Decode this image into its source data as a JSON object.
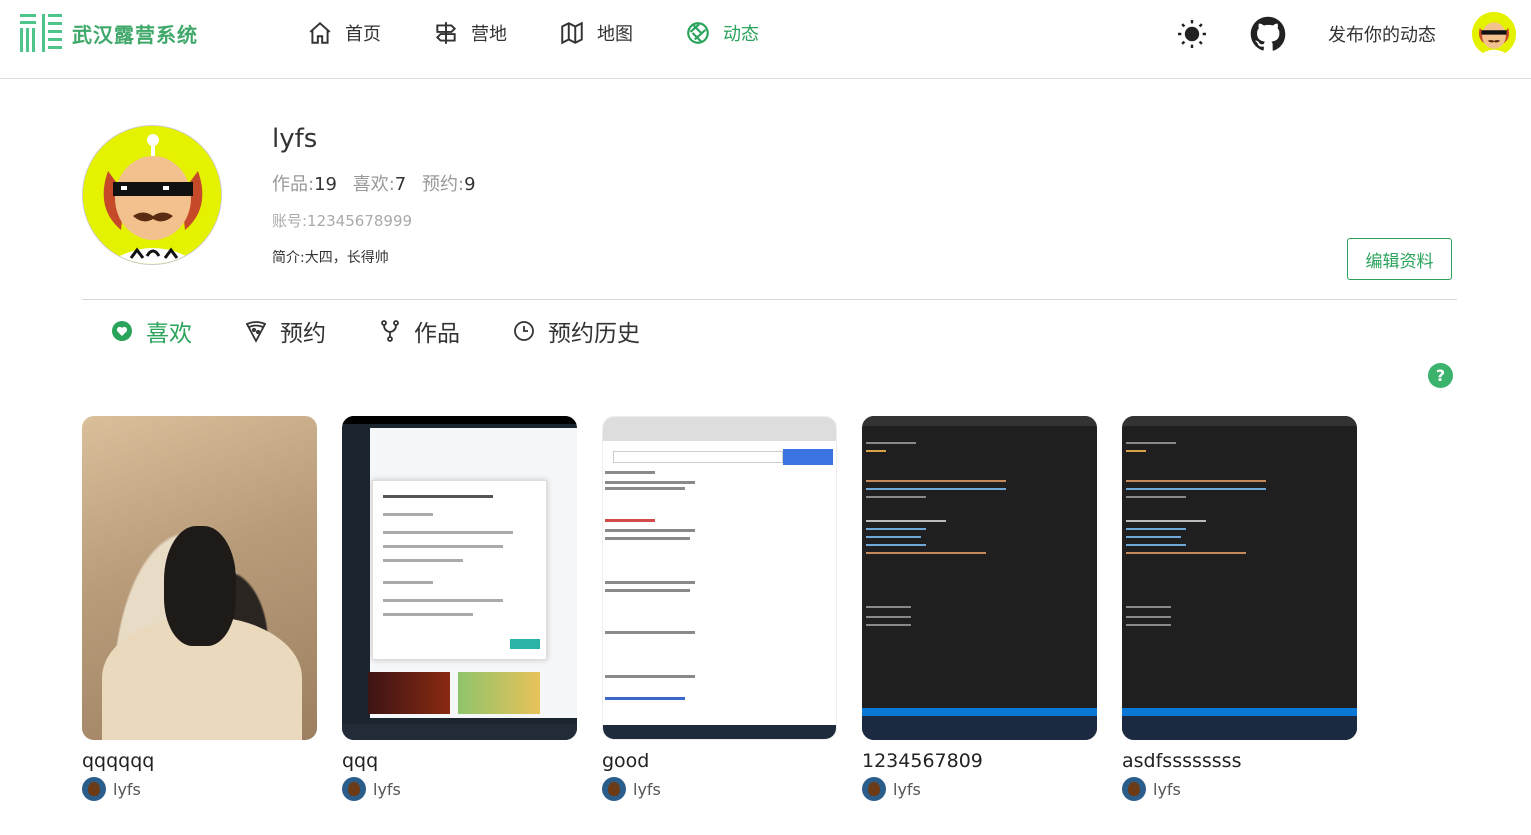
{
  "header": {
    "logo_text": "武汉露营系统",
    "nav": [
      {
        "label": "首页",
        "icon": "home-icon",
        "active": false
      },
      {
        "label": "营地",
        "icon": "signpost-icon",
        "active": false
      },
      {
        "label": "地图",
        "icon": "map-icon",
        "active": false
      },
      {
        "label": "动态",
        "icon": "aperture-icon",
        "active": true
      }
    ],
    "publish_label": "发布你的动态"
  },
  "profile": {
    "name": "lyfs",
    "works_label": "作品:",
    "works_count": "19",
    "likes_label": "喜欢:",
    "likes_count": "7",
    "bookings_label": "预约:",
    "bookings_count": "9",
    "account": "账号:12345678999",
    "bio": "简介:大四，长得帅",
    "edit_label": "编辑资料"
  },
  "tabs": [
    {
      "label": "喜欢",
      "icon": "heart-icon",
      "active": true
    },
    {
      "label": "预约",
      "icon": "pizza-icon",
      "active": false
    },
    {
      "label": "作品",
      "icon": "branch-icon",
      "active": false
    },
    {
      "label": "预约历史",
      "icon": "clock-icon",
      "active": false
    }
  ],
  "help_label": "?",
  "cards": [
    {
      "title": "qqqqqq",
      "author": "lyfs",
      "thumb": "dog-photo"
    },
    {
      "title": "qqq",
      "author": "lyfs",
      "thumb": "game-launcher-screenshot"
    },
    {
      "title": "good",
      "author": "lyfs",
      "thumb": "browser-search-screenshot"
    },
    {
      "title": "1234567809",
      "author": "lyfs",
      "thumb": "code-editor-screenshot"
    },
    {
      "title": "asdfssssssss",
      "author": "lyfs",
      "thumb": "code-editor-screenshot"
    }
  ],
  "colors": {
    "accent": "#2aa35b",
    "logo": "#3fa86a",
    "avatar_bg": "#e4f200"
  }
}
